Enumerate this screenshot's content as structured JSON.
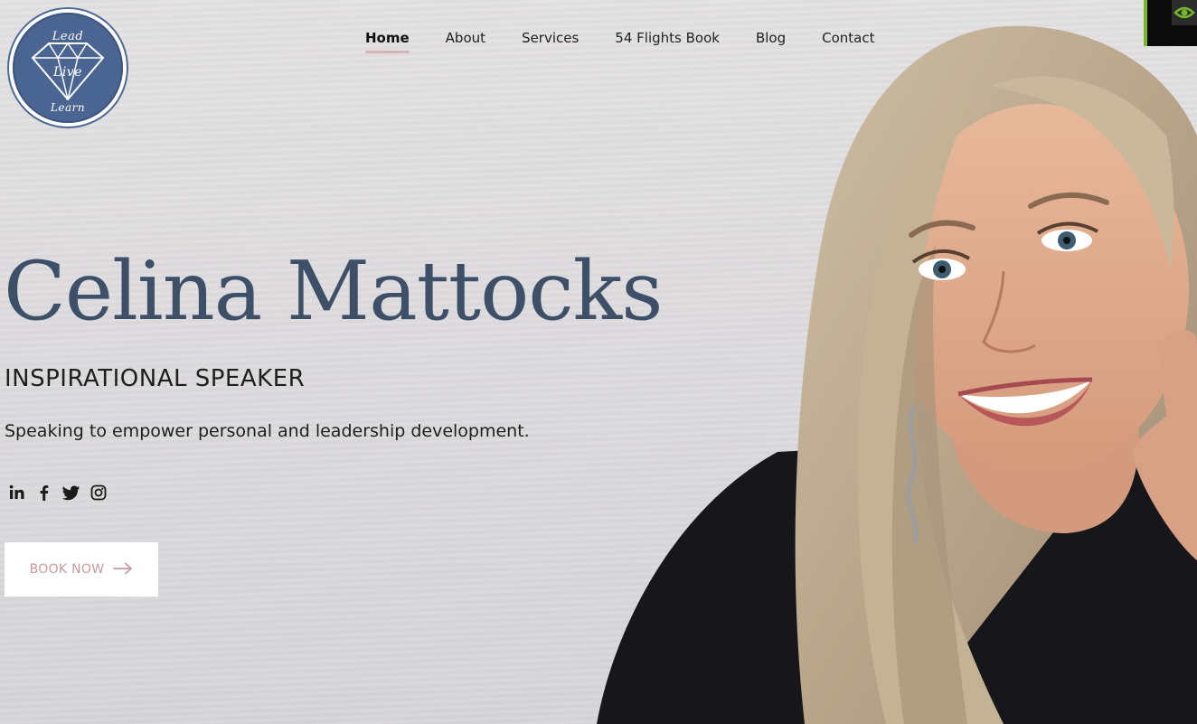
{
  "logo": {
    "words": [
      "Lead",
      "Live",
      "Learn"
    ],
    "colors": {
      "ring": "#4c6a95",
      "fill": "#4a6591"
    }
  },
  "nav": {
    "items": [
      {
        "label": "Home",
        "active": true
      },
      {
        "label": "About"
      },
      {
        "label": "Services"
      },
      {
        "label": "54 Flights Book"
      },
      {
        "label": "Blog"
      },
      {
        "label": "Contact"
      }
    ],
    "active_underline_color": "#d8b4b8"
  },
  "hero": {
    "name": "Celina Mattocks",
    "role": "INSPIRATIONAL SPEAKER",
    "tagline": "Speaking to empower personal and leadership development.",
    "name_color": "#3d5068"
  },
  "socials": [
    {
      "icon": "linkedin-icon"
    },
    {
      "icon": "facebook-icon"
    },
    {
      "icon": "twitter-icon"
    },
    {
      "icon": "instagram-icon"
    }
  ],
  "cta": {
    "label": "BOOK NOW",
    "icon": "arrow-right-icon",
    "text_color": "#c59aa0"
  },
  "corner_widget": {
    "accent": "#75b82a"
  }
}
